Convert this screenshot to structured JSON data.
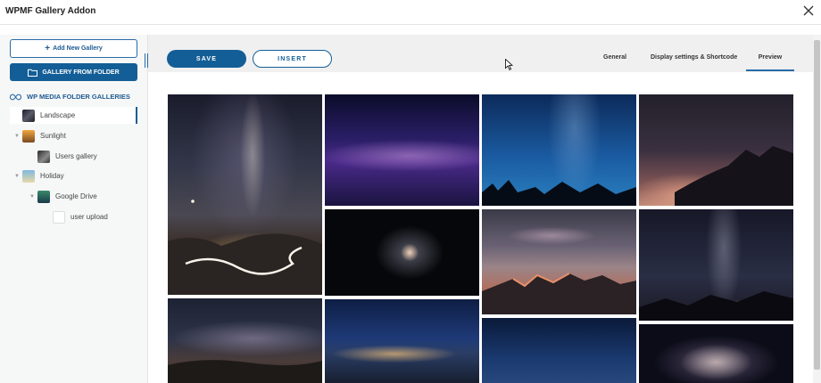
{
  "window": {
    "title": "WPMF Gallery Addon",
    "close_icon": "close-icon"
  },
  "sidebar": {
    "add_button": {
      "plus": "+",
      "label": "Add New Gallery"
    },
    "folder_button": {
      "label": "GALLERY FROM FOLDER",
      "icon": "folder-icon"
    },
    "section_title": "WP MEDIA FOLDER GALLERIES",
    "section_icon": "infinity-icon",
    "tree": [
      {
        "label": "Landscape",
        "active": true
      },
      {
        "label": "Sunlight",
        "expanded": true
      },
      {
        "label": "Users gallery"
      },
      {
        "label": "Holiday",
        "expanded": true
      },
      {
        "label": "Google Drive",
        "expanded": true
      },
      {
        "label": "user upload"
      }
    ]
  },
  "toolbar": {
    "save_label": "SAVE",
    "insert_label": "INSERT"
  },
  "tabs": [
    {
      "label": "General",
      "active": false
    },
    {
      "label": "Display settings & Shortcode",
      "active": false
    },
    {
      "label": "Preview",
      "active": true
    }
  ],
  "accent_color": "#135e96",
  "gallery": {
    "photos": [
      {
        "name": "milky-way-road"
      },
      {
        "name": "purple-milky-way"
      },
      {
        "name": "blue-starry-trees"
      },
      {
        "name": "sunset-mountain-lake"
      },
      {
        "name": "spiral-galaxy"
      },
      {
        "name": "red-peaks-clouds"
      },
      {
        "name": "milky-way-hills"
      },
      {
        "name": "milky-way-desert"
      },
      {
        "name": "blue-night-city"
      },
      {
        "name": "dark-blue-sky"
      },
      {
        "name": "colliding-galaxies"
      }
    ]
  }
}
